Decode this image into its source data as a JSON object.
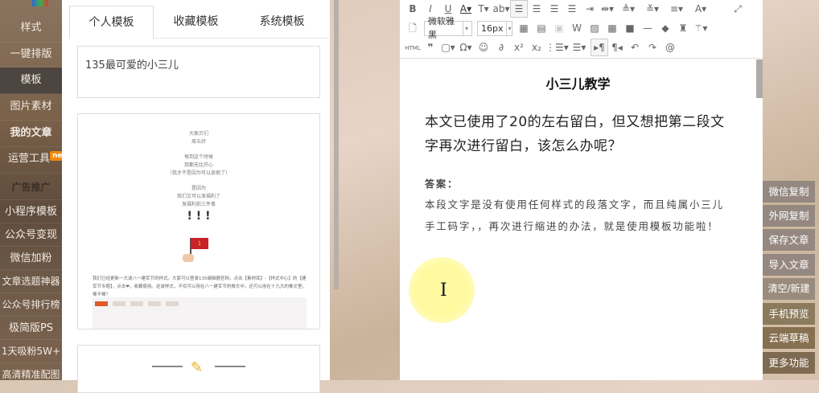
{
  "sidebar": {
    "items": [
      "样式",
      "一键排版",
      "模板",
      "图片素材",
      "我的文章",
      "运营工具",
      "广告推广",
      "小程序模板",
      "公众号变现",
      "微信加粉",
      "文章选题神器",
      "公众号排行榜",
      "极简版PS",
      "1天吸粉5W+",
      "高清精准配图"
    ],
    "badge": "new"
  },
  "panel": {
    "tabs": [
      "个人模板",
      "收藏模板",
      "系统模板"
    ],
    "card1_text": "135最可爱的小三儿",
    "preview": {
      "lines": [
        "大家贝们",
        "周五好",
        "",
        "每到这个时候",
        "我都无比开心",
        "（我才不是因为可以放假了）",
        "",
        "是因为",
        "我们又可以发福利了",
        "发福利前三件事"
      ],
      "marks": "! ! !",
      "flag_number": "1",
      "paragraph": "我们已经更新一大波八一建军节的样式。大家可以登录135编辑器官网，点击【素材库】-【样式中心】的【建军节专题】，点击❤，收藏使用。这波样式，不仅可以用在八一建军节的推文中，还可以用在十九大的推文里，棒不棒？"
    }
  },
  "toolbar": {
    "font_family": "微软雅黑",
    "font_size": "16px",
    "html_label": "HTML"
  },
  "editor": {
    "title": "小三儿教学",
    "lead": "本文已使用了20的左右留白，但又想把第二段文字再次进行留白，该怎么办呢？",
    "answer_label": "答案：",
    "body": "本段文字是没有使用任何样式的段落文字，而且纯属小三儿手工码字，，再次进行缩进的办法，就是使用模板功能啦！"
  },
  "right_buttons": [
    "微信复制",
    "外网复制",
    "保存文章",
    "导入文章",
    "清空/新建",
    "手机预览",
    "云端草稿",
    "更多功能"
  ]
}
